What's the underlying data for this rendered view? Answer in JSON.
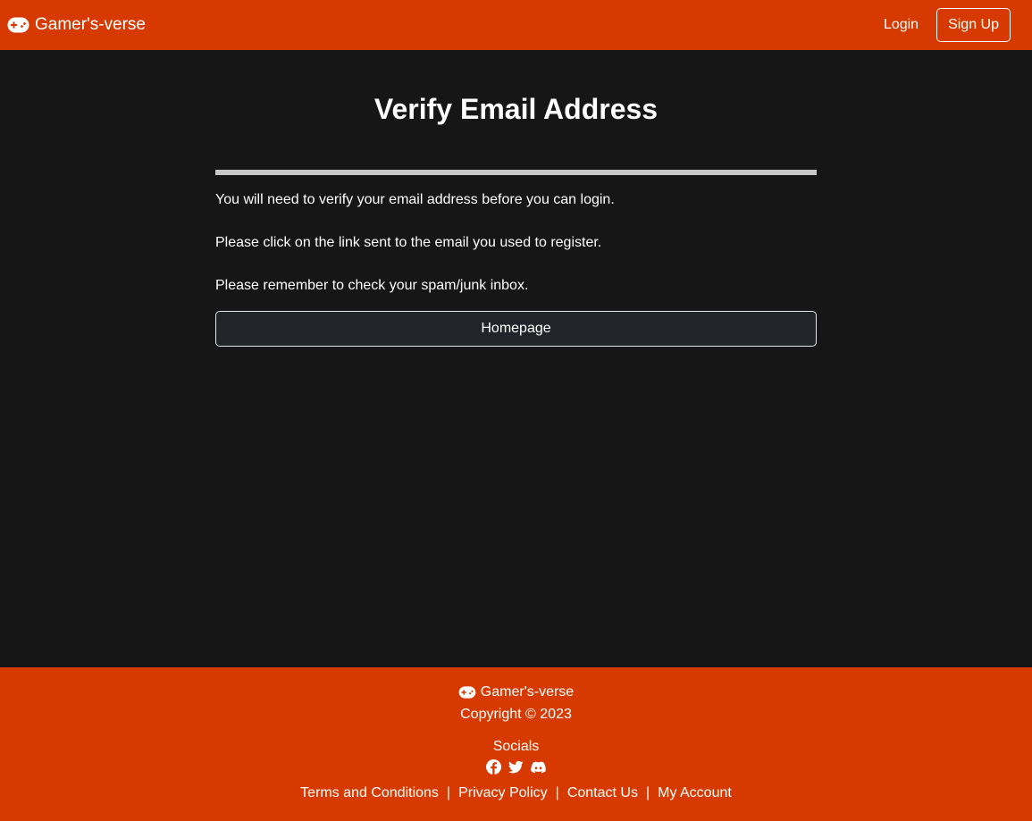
{
  "navbar": {
    "brand": "Gamer's-verse",
    "brand_icon": "gamepad-icon",
    "login_label": "Login",
    "signup_label": "Sign Up",
    "background_color": "#d63a00"
  },
  "main": {
    "title": "Verify Email Address",
    "messages": [
      "You will need to verify your email address before you can login.",
      "Please click on the link sent to the email you used to register.",
      "Please remember to check your spam/junk inbox."
    ],
    "homepage_button": "Homepage",
    "background_color": "#161616"
  },
  "footer": {
    "brand": "Gamer's-verse",
    "brand_icon": "gamepad-icon",
    "copyright": "Copyright © 2023",
    "socials_label": "Socials",
    "social_icons": [
      "facebook-icon",
      "twitter-icon",
      "discord-icon"
    ],
    "links": [
      "Terms and Conditions",
      "Privacy Policy",
      "Contact Us",
      "My Account"
    ],
    "separator": "|"
  }
}
